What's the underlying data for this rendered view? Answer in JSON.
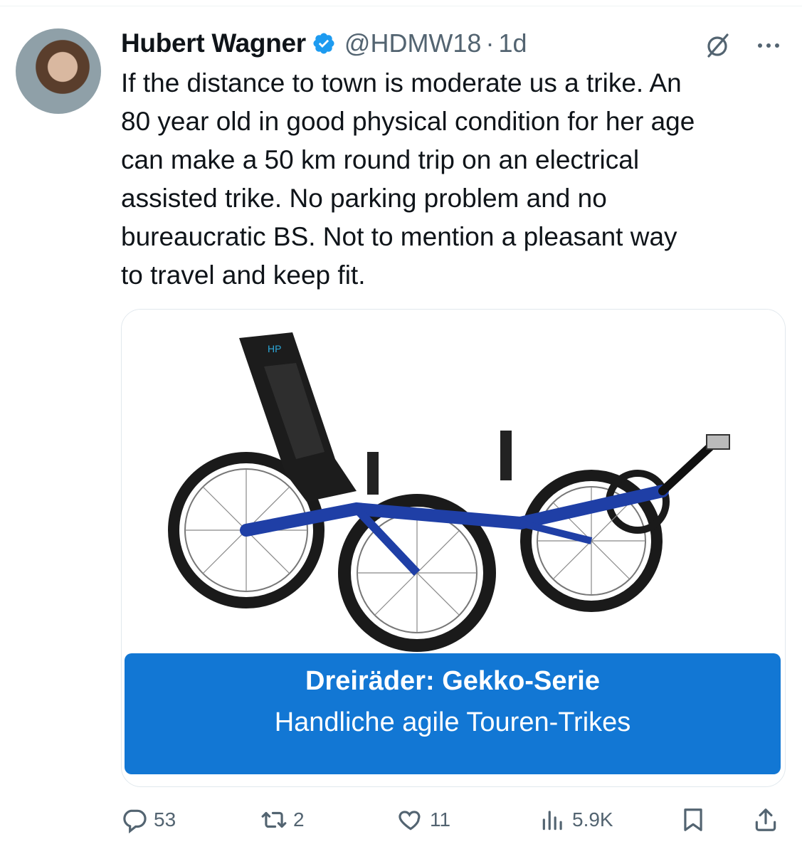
{
  "author": {
    "name": "Hubert Wagner",
    "handle": "@HDMW18",
    "separator": "·",
    "time": "1d",
    "verified_color": "#1d9bf0"
  },
  "icons": {
    "header_right": [
      "grok-icon",
      "more-icon"
    ],
    "actions": [
      "reply-icon",
      "retweet-icon",
      "like-icon",
      "views-icon",
      "bookmark-icon",
      "share-icon"
    ]
  },
  "tweet": {
    "text": "If the distance to town is moderate us a trike. An\n80 year old in good physical condition for her age\ncan make a 50 km round trip on an electrical\nassisted trike. No parking problem and no\nbureaucratic BS. Not to mention a pleasant way\nto travel and keep fit."
  },
  "card": {
    "title": "Dreiräder: Gekko-Serie",
    "subtitle": "Handliche agile Touren-Trikes",
    "banner_color": "#1277d4"
  },
  "actions": {
    "replies": "53",
    "retweets": "2",
    "likes": "11",
    "views": "5.9K"
  }
}
